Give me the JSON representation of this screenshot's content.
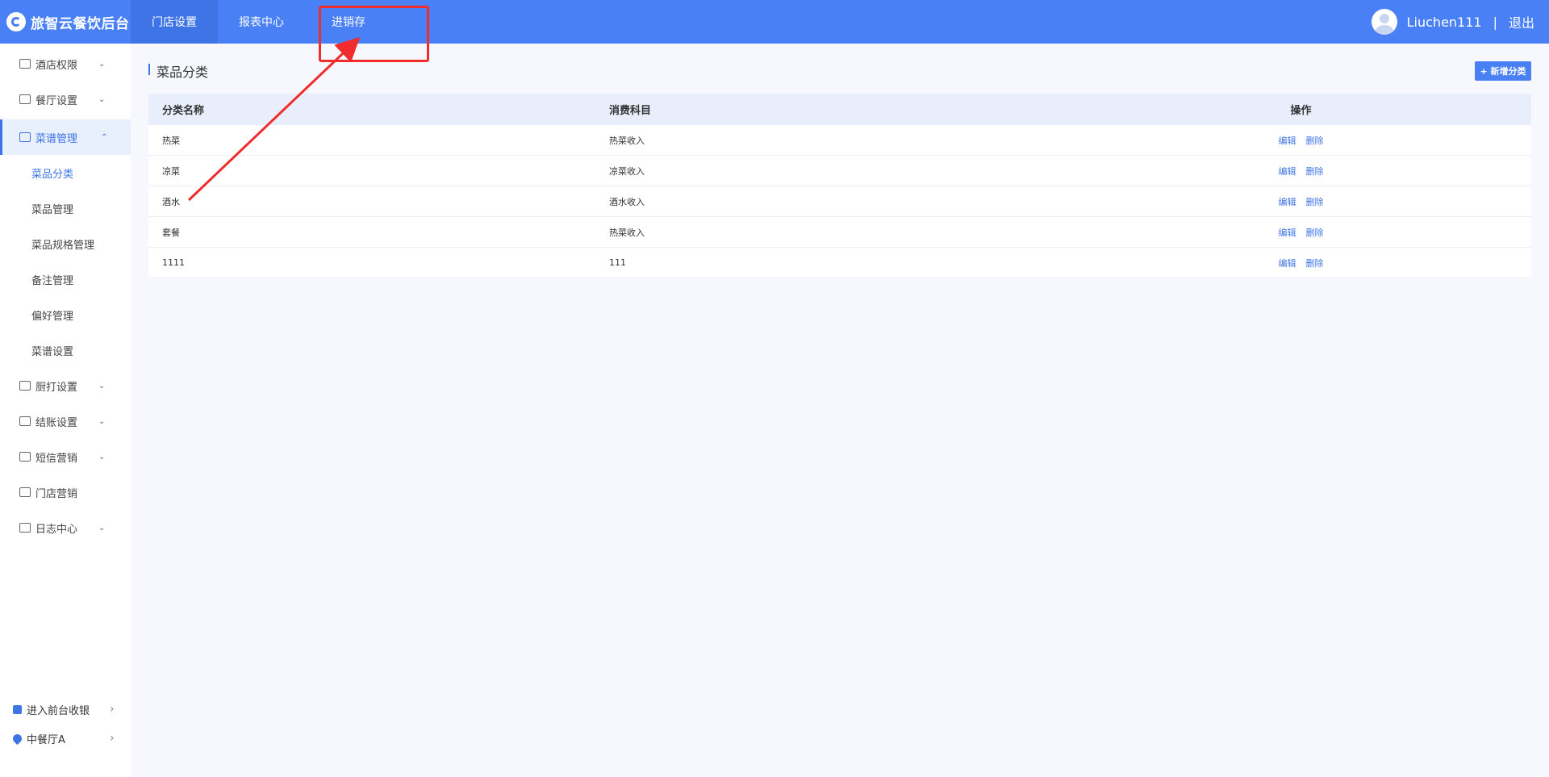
{
  "header": {
    "brand": "旅智云餐饮后台",
    "tabs": [
      {
        "label": "门店设置",
        "active": true
      },
      {
        "label": "报表中心",
        "active": false
      },
      {
        "label": "进销存",
        "active": false
      }
    ],
    "username": "Liuchen111",
    "separator": "|",
    "logout": "退出"
  },
  "sidebar": {
    "menus": [
      {
        "label": "酒店权限",
        "icon": "building-icon",
        "expandable": true
      },
      {
        "label": "餐厅设置",
        "icon": "home-icon",
        "expandable": true
      },
      {
        "label": "菜谱管理",
        "icon": "grid-icon",
        "expandable": true,
        "open": true
      },
      {
        "label": "厨打设置",
        "icon": "printer-icon",
        "expandable": true
      },
      {
        "label": "结账设置",
        "icon": "checkout-icon",
        "expandable": true
      },
      {
        "label": "短信营销",
        "icon": "mail-icon",
        "expandable": true
      },
      {
        "label": "门店营销",
        "icon": "store-icon",
        "expandable": false
      },
      {
        "label": "日志中心",
        "icon": "log-icon",
        "expandable": true
      }
    ],
    "submenu": [
      {
        "label": "菜品分类",
        "active": true
      },
      {
        "label": "菜品管理"
      },
      {
        "label": "菜品规格管理"
      },
      {
        "label": "备注管理"
      },
      {
        "label": "偏好管理"
      },
      {
        "label": "菜谱设置"
      }
    ],
    "bottom": {
      "cashier": "进入前台收银",
      "restaurant": "中餐厅A"
    }
  },
  "main": {
    "title": "菜品分类",
    "add_button": "+ 新增分类",
    "table": {
      "headers": [
        "分类名称",
        "消费科目",
        "操作"
      ],
      "rows": [
        {
          "name": "热菜",
          "subject": "热菜收入"
        },
        {
          "name": "凉菜",
          "subject": "凉菜收入"
        },
        {
          "name": "酒水",
          "subject": "酒水收入"
        },
        {
          "name": "套餐",
          "subject": "热菜收入"
        },
        {
          "name": "1111",
          "subject": "111"
        }
      ],
      "edit_label": "编辑",
      "delete_label": "删除"
    }
  },
  "colors": {
    "primary": "#4a80f5",
    "accent": "#3f74e6",
    "annotation": "#f02c2c"
  }
}
